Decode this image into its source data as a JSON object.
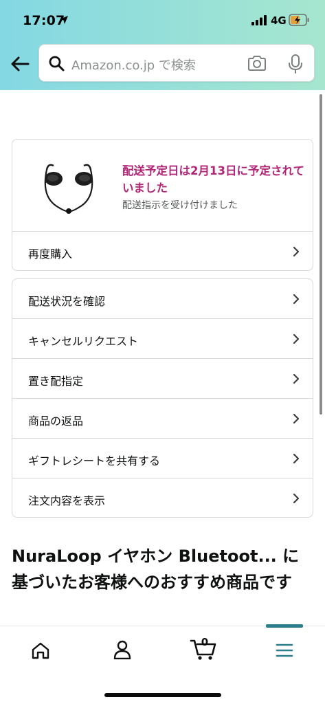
{
  "status_bar": {
    "time": "17:07",
    "network": "4G"
  },
  "search": {
    "placeholder": "Amazon.co.jp で検索"
  },
  "order": {
    "delivery_title": "配送予定日は2月13日に予定されていました",
    "delivery_subtitle": "配送指示を受け付けました",
    "buy_again_label": "再度購入"
  },
  "actions": [
    {
      "label": "配送状況を確認"
    },
    {
      "label": "キャンセルリクエスト"
    },
    {
      "label": "置き配指定"
    },
    {
      "label": "商品の返品"
    },
    {
      "label": "ギフトレシートを共有する"
    },
    {
      "label": "注文内容を表示"
    }
  ],
  "recommendations": {
    "title": "NuraLoop イヤホン Bluetoot... に基づいたお客様へのおすすめ商品です"
  },
  "bottom_nav": {
    "cart_count": "0",
    "active_tab": "menu"
  },
  "colors": {
    "header_gradient_start": "#84d8e3",
    "header_gradient_end": "#a6e6cf",
    "delivery_accent": "#b12777",
    "nav_active": "#2c7e8e"
  },
  "icons": [
    "location-arrow-icon",
    "signal-icon",
    "battery-icon",
    "back-arrow-icon",
    "search-icon",
    "camera-icon",
    "mic-icon",
    "chevron-right-icon",
    "home-icon",
    "account-icon",
    "cart-icon",
    "menu-icon"
  ]
}
